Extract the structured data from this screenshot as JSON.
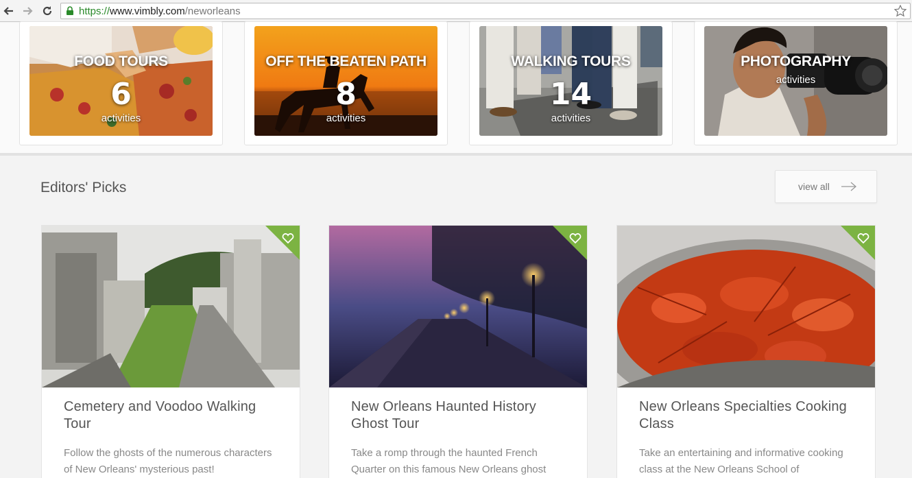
{
  "browser": {
    "url_scheme": "https://",
    "url_host": "www.vimbly.com",
    "url_path": "/neworleans"
  },
  "categories": [
    {
      "title": "FOOD TOURS",
      "count": "6",
      "sub": "activities"
    },
    {
      "title": "OFF THE BEATEN PATH",
      "count": "8",
      "sub": "activities"
    },
    {
      "title": "WALKING TOURS",
      "count": "14",
      "sub": "activities"
    },
    {
      "title": "PHOTOGRAPHY",
      "count": "",
      "sub": "activities"
    }
  ],
  "editors": {
    "title": "Editors' Picks",
    "view_all": "view all"
  },
  "picks": [
    {
      "title": "Cemetery and Voodoo Walking Tour",
      "desc": "Follow the ghosts of the numerous characters of New Orleans' mysterious past!"
    },
    {
      "title": "New Orleans Haunted History Ghost Tour",
      "desc": "Take a romp through the haunted French Quarter on this famous New Orleans ghost"
    },
    {
      "title": "New Orleans Specialties Cooking Class",
      "desc": "Take an entertaining and informative cooking class at the New Orleans School of"
    }
  ],
  "colors": {
    "accent_green": "#7cb342",
    "text_dark": "#555555",
    "text_muted": "#888888"
  }
}
